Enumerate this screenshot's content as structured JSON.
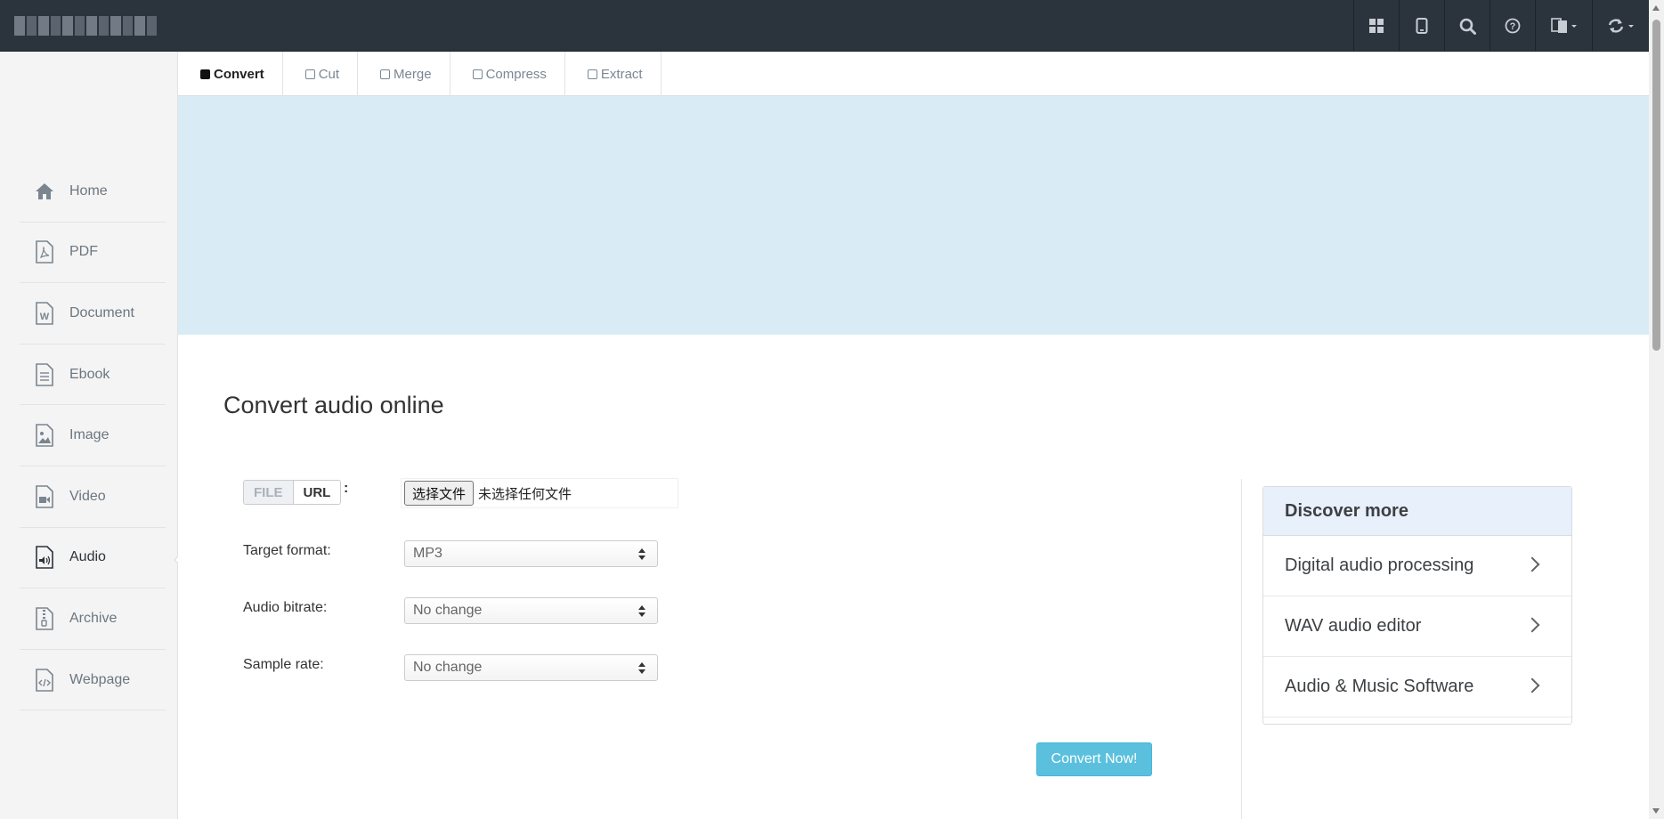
{
  "topbar": {
    "tools": [
      {
        "name": "apps-grid-icon"
      },
      {
        "name": "tablet-icon"
      },
      {
        "name": "search-icon"
      },
      {
        "name": "help-icon"
      },
      {
        "name": "language-icon"
      },
      {
        "name": "refresh-icon"
      }
    ]
  },
  "sidebar": {
    "items": [
      {
        "label": "Home",
        "icon": "home-icon"
      },
      {
        "label": "PDF",
        "icon": "pdf-file-icon"
      },
      {
        "label": "Document",
        "icon": "word-file-icon"
      },
      {
        "label": "Ebook",
        "icon": "ebook-file-icon"
      },
      {
        "label": "Image",
        "icon": "image-file-icon"
      },
      {
        "label": "Video",
        "icon": "video-file-icon"
      },
      {
        "label": "Audio",
        "icon": "audio-file-icon",
        "active": true
      },
      {
        "label": "Archive",
        "icon": "archive-file-icon"
      },
      {
        "label": "Webpage",
        "icon": "code-file-icon"
      }
    ]
  },
  "tabs": [
    {
      "label": "Convert",
      "active": true
    },
    {
      "label": "Cut"
    },
    {
      "label": "Merge"
    },
    {
      "label": "Compress"
    },
    {
      "label": "Extract"
    }
  ],
  "main": {
    "heading": "Convert audio online",
    "source": {
      "file_label": "FILE",
      "url_label": "URL",
      "colon": ":"
    },
    "file_input": {
      "button": "选择文件",
      "status": "未选择任何文件"
    },
    "target_format": {
      "label": "Target format:",
      "value": "MP3"
    },
    "audio_bitrate": {
      "label": "Audio bitrate:",
      "value": "No change"
    },
    "sample_rate": {
      "label": "Sample rate:",
      "value": "No change"
    },
    "convert_button": "Convert Now!"
  },
  "discover": {
    "title": "Discover more",
    "items": [
      "Digital audio processing",
      "WAV audio editor",
      "Audio & Music Software"
    ]
  },
  "colors": {
    "topbar": "#2b333d",
    "banner": "#d9ecf5",
    "convert_button": "#5bc0de",
    "discover_header": "#e8f0fc"
  }
}
